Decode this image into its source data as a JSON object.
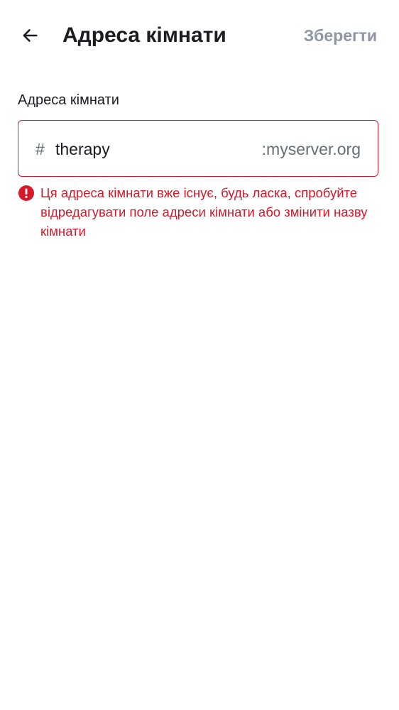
{
  "header": {
    "back_icon": "arrow-left-icon",
    "title": "Адреса кімнати",
    "save_label": "Зберегти"
  },
  "address_field": {
    "label": "Адреса кімнати",
    "prefix": "#",
    "value": "therapy",
    "suffix": ":myserver.org"
  },
  "error": {
    "icon": "error-circle-icon",
    "message": "Ця адреса кімнати вже існує, будь ласка, спробуйте відредагувати поле адреси кімнати або змінити назву кімнати"
  },
  "colors": {
    "error": "#d51928",
    "disabled_action": "#8d97a5",
    "secondary_text": "#656d77",
    "primary_text": "#1b1d22"
  }
}
